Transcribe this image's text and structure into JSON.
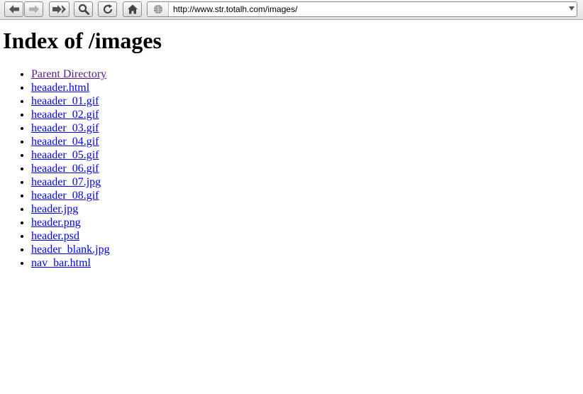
{
  "toolbar": {
    "back_icon": "back-arrow-icon",
    "forward_icon": "forward-arrow-icon",
    "forward_list_icon": "double-forward-icon",
    "search_icon": "magnifier-icon",
    "reload_icon": "reload-icon",
    "home_icon": "home-icon",
    "site_icon": "globe-icon"
  },
  "address_bar": {
    "url": "http://www.str.totalh.com/images/"
  },
  "page": {
    "title": "Index of /images",
    "links": [
      {
        "label": "Parent Directory",
        "visited": true
      },
      {
        "label": "heaader.html"
      },
      {
        "label": "heaader_01.gif"
      },
      {
        "label": "heaader_02.gif"
      },
      {
        "label": "heaader_03.gif"
      },
      {
        "label": "heaader_04.gif"
      },
      {
        "label": "heaader_05.gif"
      },
      {
        "label": "heaader_06.gif"
      },
      {
        "label": "heaader_07.jpg"
      },
      {
        "label": "heaader_08.gif"
      },
      {
        "label": "header.jpg"
      },
      {
        "label": "header.png"
      },
      {
        "label": "header.psd"
      },
      {
        "label": "header_blank.jpg"
      },
      {
        "label": "nav_bar.html"
      }
    ]
  },
  "colors": {
    "link": "#0000ee",
    "visited_link": "#551a8b"
  }
}
